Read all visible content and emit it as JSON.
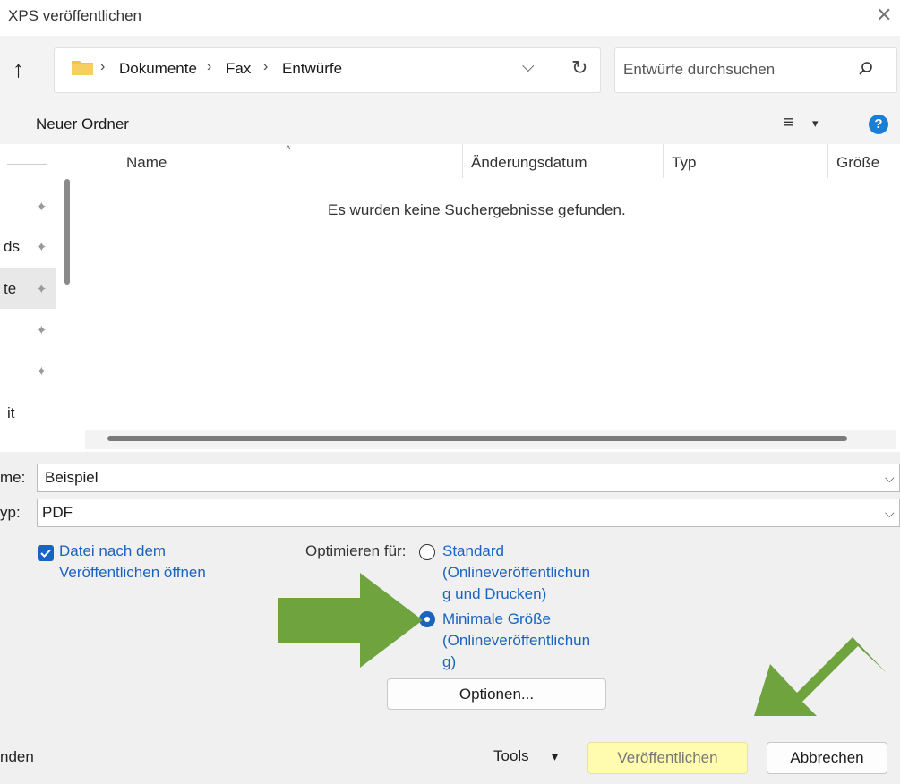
{
  "window": {
    "title": "XPS veröffentlichen",
    "close_glyph": "✕"
  },
  "nav": {
    "up_glyph": "↑",
    "breadcrumb": [
      "Dokumente",
      "Fax",
      "Entwürfe"
    ],
    "dropdown_glyph": "⌵",
    "refresh_glyph": "↻",
    "search_placeholder": "Entwürfe durchsuchen",
    "search_glyph": "⚲"
  },
  "commands": {
    "new_folder": "Neuer Ordner",
    "view_glyph": "≡",
    "caret": "▾",
    "help": "?"
  },
  "sidebar": {
    "items": [
      "",
      "ds",
      "te",
      "",
      "",
      "it"
    ],
    "pin_glyph": "📌"
  },
  "columns": {
    "name": "Name",
    "sort_glyph": "^",
    "date": "Änderungsdatum",
    "type": "Typ",
    "size": "Größe"
  },
  "content": {
    "empty_message": "Es wurden keine Suchergebnisse gefunden."
  },
  "form": {
    "filename_label": "me:",
    "filename_value": "Beispiel",
    "filetype_label": "yp:",
    "filetype_value": "PDF",
    "open_after_line1": "Datei nach dem",
    "open_after_line2": "Veröffentlichen öffnen",
    "open_after_checked": true,
    "optimize_label": "Optimieren für:",
    "option_standard_lines": [
      "Standard",
      "(Onlineveröffentlichun",
      "g und Drucken)"
    ],
    "option_minimal_lines": [
      "Minimale Größe",
      "(Onlineveröffentlichun",
      "g)"
    ],
    "selected_option": "minimal",
    "options_button": "Optionen..."
  },
  "footer": {
    "left_text": "nden",
    "tools": "Tools",
    "tools_caret": "▾",
    "publish": "Veröffentlichen",
    "cancel": "Abbrechen"
  },
  "colors": {
    "accent": "#1a63c0",
    "help": "#1a7fd4",
    "arrow": "#6fa33e",
    "highlight": "#fffcb0",
    "folder": "#f4c24a"
  }
}
